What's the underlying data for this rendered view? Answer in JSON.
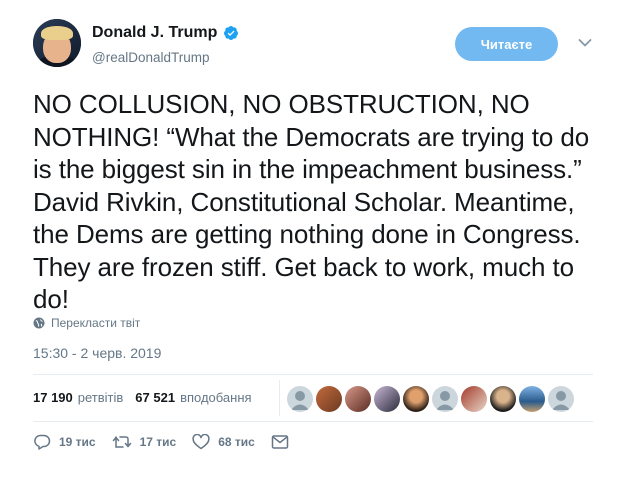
{
  "author": {
    "display_name": "Donald J. Trump",
    "handle": "@realDonaldTrump",
    "verified": true
  },
  "follow_button": {
    "label": "Читаєте"
  },
  "tweet": {
    "text": "NO COLLUSION, NO OBSTRUCTION, NO NOTHING! “What the Democrats are trying to do is the biggest sin in the impeachment business.” David Rivkin, Constitutional Scholar. Meantime, the Dems are getting nothing done in Congress. They are frozen stiff. Get back to work, much to do!",
    "translate_label": "Перекласти твіт",
    "timestamp": "15:30 - 2 черв. 2019"
  },
  "stats": {
    "retweets_count": "17 190",
    "retweets_label": "ретвітів",
    "likes_count": "67 521",
    "likes_label": "вподобання"
  },
  "actions": {
    "reply_count": "19 тис",
    "retweet_count": "17 тис",
    "like_count": "68 тис"
  },
  "colors": {
    "accent": "#1da1f2",
    "follow_bg": "#71b9f0",
    "secondary_text": "#657786",
    "divider": "#e6ecf0"
  },
  "icons": [
    "verified-badge-icon",
    "caret-down-icon",
    "globe-icon",
    "reply-icon",
    "retweet-icon",
    "heart-icon",
    "message-icon"
  ]
}
